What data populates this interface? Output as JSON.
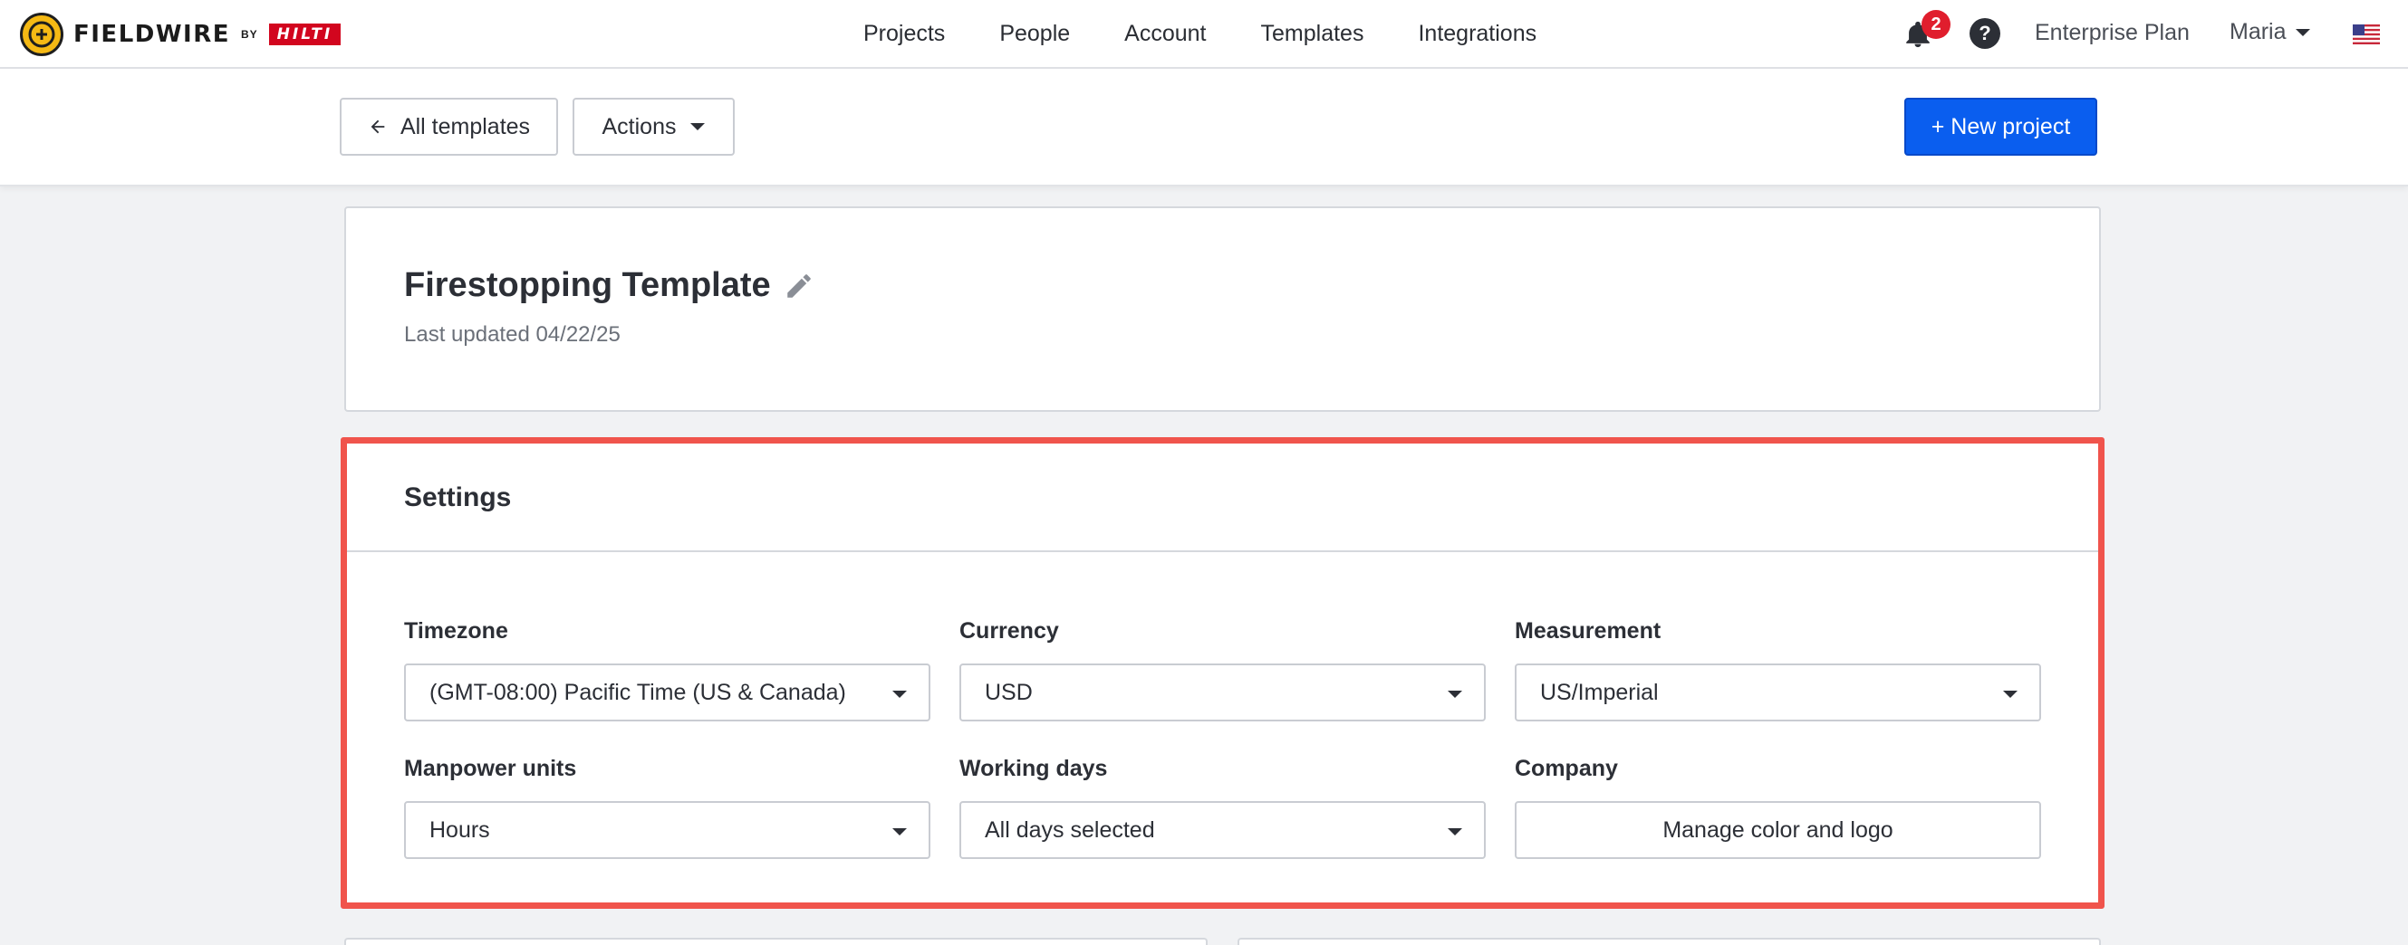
{
  "brand": {
    "name": "FIELDWIRE",
    "by": "BY",
    "partner": "HILTI"
  },
  "nav": {
    "items": [
      {
        "label": "Projects"
      },
      {
        "label": "People"
      },
      {
        "label": "Account"
      },
      {
        "label": "Templates"
      },
      {
        "label": "Integrations"
      }
    ],
    "notifications_count": "2",
    "help_icon": "?",
    "plan": "Enterprise Plan",
    "user": "Maria"
  },
  "toolbar": {
    "back_label": "All templates",
    "actions_label": "Actions",
    "new_project_label": "+ New project"
  },
  "template": {
    "title": "Firestopping Template",
    "last_updated": "Last updated 04/22/25"
  },
  "settings": {
    "title": "Settings",
    "timezone": {
      "label": "Timezone",
      "value": "(GMT-08:00) Pacific Time (US & Canada)"
    },
    "currency": {
      "label": "Currency",
      "value": "USD"
    },
    "measurement": {
      "label": "Measurement",
      "value": "US/Imperial"
    },
    "manpower": {
      "label": "Manpower units",
      "value": "Hours"
    },
    "working_days": {
      "label": "Working days",
      "value": "All days selected"
    },
    "company": {
      "label": "Company",
      "button": "Manage color and logo"
    }
  },
  "colors": {
    "primary": "#0a5eef",
    "highlight_border": "#f0544c",
    "badge": "#e01e2d",
    "logo_yellow": "#f5b914",
    "hilti_red": "#d2051e"
  }
}
